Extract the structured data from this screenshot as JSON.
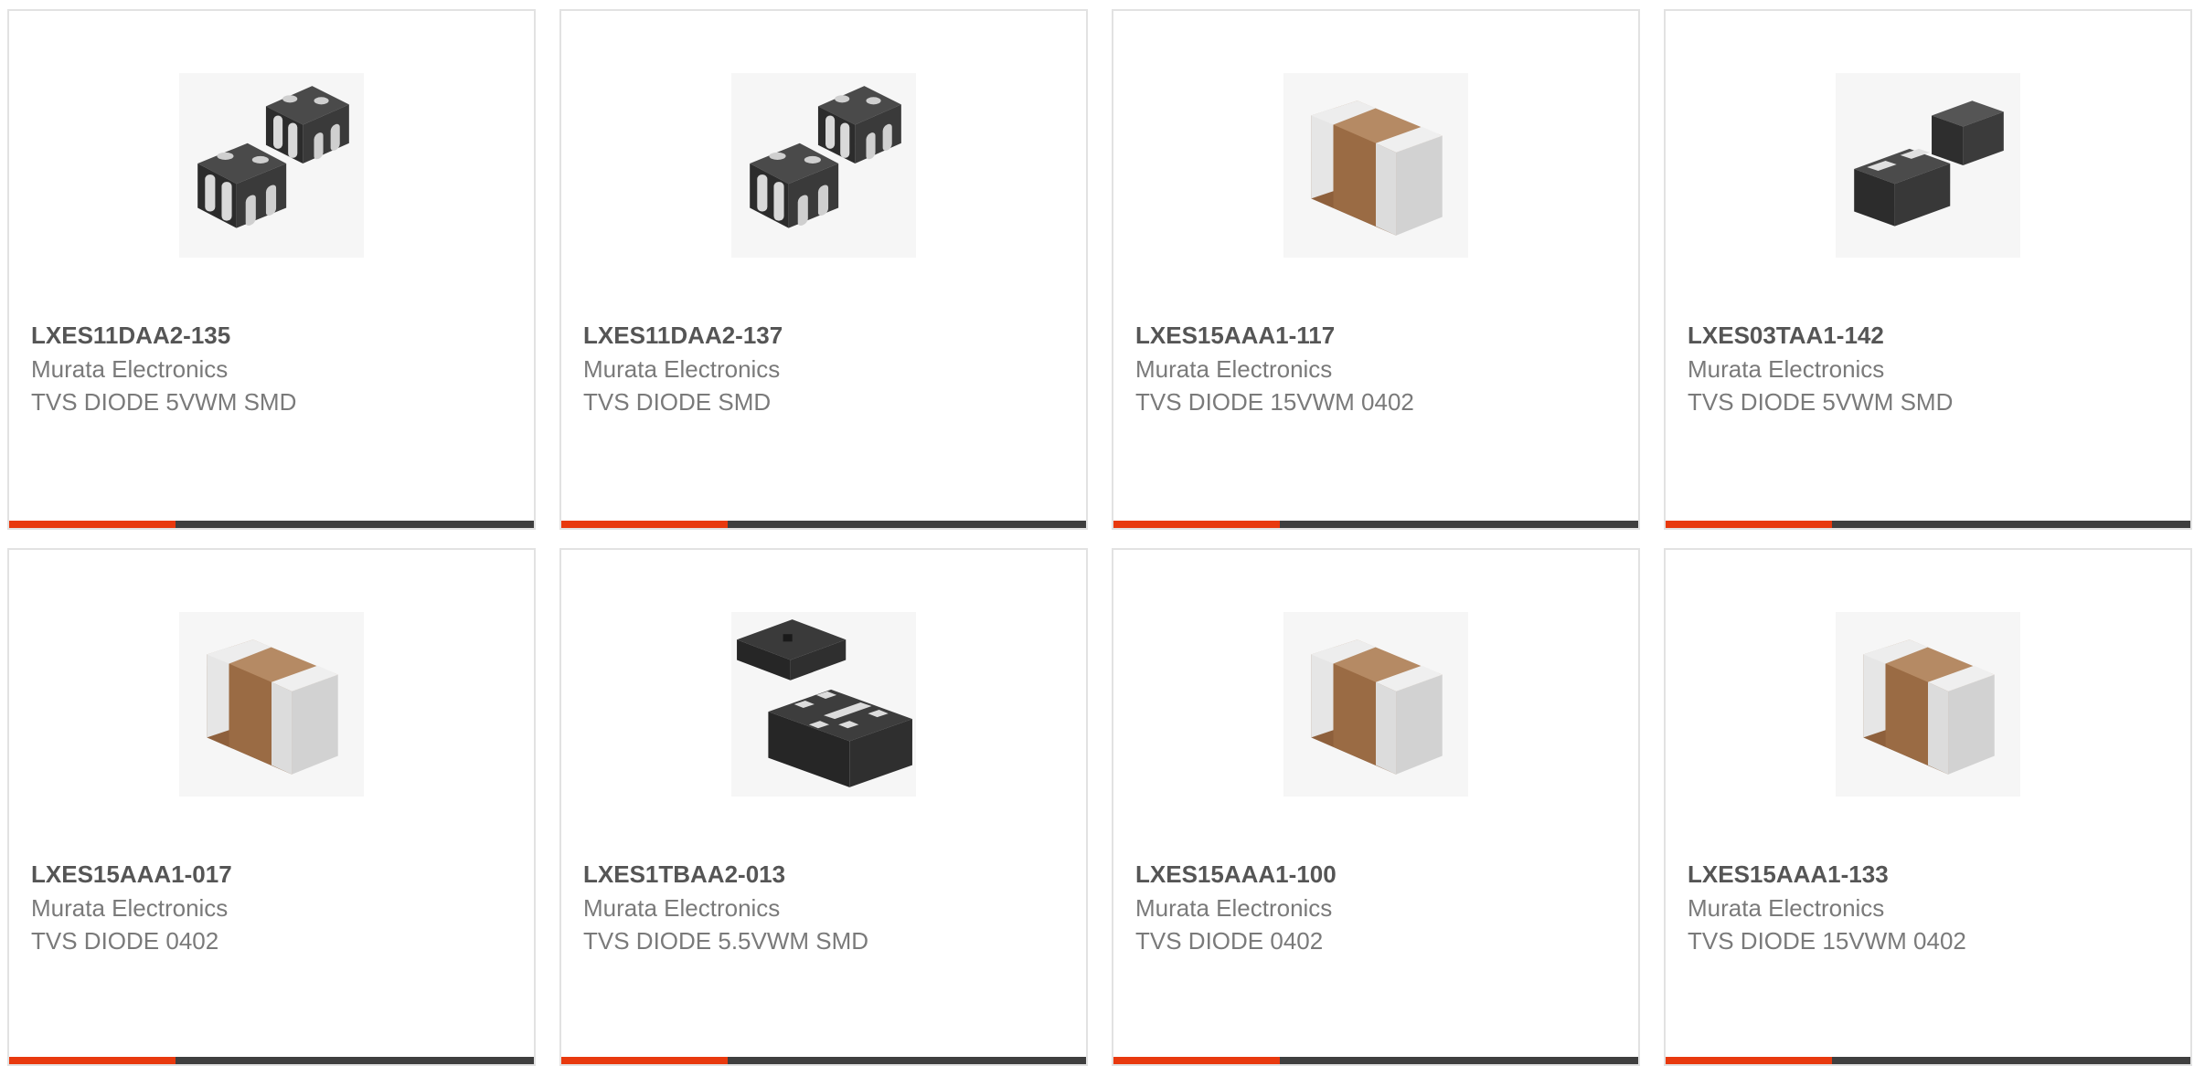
{
  "colors": {
    "accent": "#e8390e",
    "bar": "#3f3f3f",
    "border": "#e2e2e2",
    "part_number": "#555555",
    "secondary_text": "#7a7a7a"
  },
  "products": [
    {
      "part_number": "LXES11DAA2-135",
      "manufacturer": "Murata Electronics",
      "description": "TVS DIODE 5VWM SMD",
      "image_icon": "dual-chip-array-icon"
    },
    {
      "part_number": "LXES11DAA2-137",
      "manufacturer": "Murata Electronics",
      "description": "TVS DIODE SMD",
      "image_icon": "dual-chip-array-icon"
    },
    {
      "part_number": "LXES15AAA1-117",
      "manufacturer": "Murata Electronics",
      "description": "TVS DIODE 15VWM 0402",
      "image_icon": "ceramic-chip-0402-icon"
    },
    {
      "part_number": "LXES03TAA1-142",
      "manufacturer": "Murata Electronics",
      "description": "TVS DIODE 5VWM SMD",
      "image_icon": "dark-smd-package-icon"
    },
    {
      "part_number": "LXES15AAA1-017",
      "manufacturer": "Murata Electronics",
      "description": "TVS DIODE 0402",
      "image_icon": "ceramic-chip-0402-icon"
    },
    {
      "part_number": "LXES1TBAA2-013",
      "manufacturer": "Murata Electronics",
      "description": "TVS DIODE 5.5VWM SMD",
      "image_icon": "dfn-package-icon"
    },
    {
      "part_number": "LXES15AAA1-100",
      "manufacturer": "Murata Electronics",
      "description": "TVS DIODE 0402",
      "image_icon": "ceramic-chip-0402-icon"
    },
    {
      "part_number": "LXES15AAA1-133",
      "manufacturer": "Murata Electronics",
      "description": "TVS DIODE 15VWM 0402",
      "image_icon": "ceramic-chip-0402-icon"
    }
  ]
}
